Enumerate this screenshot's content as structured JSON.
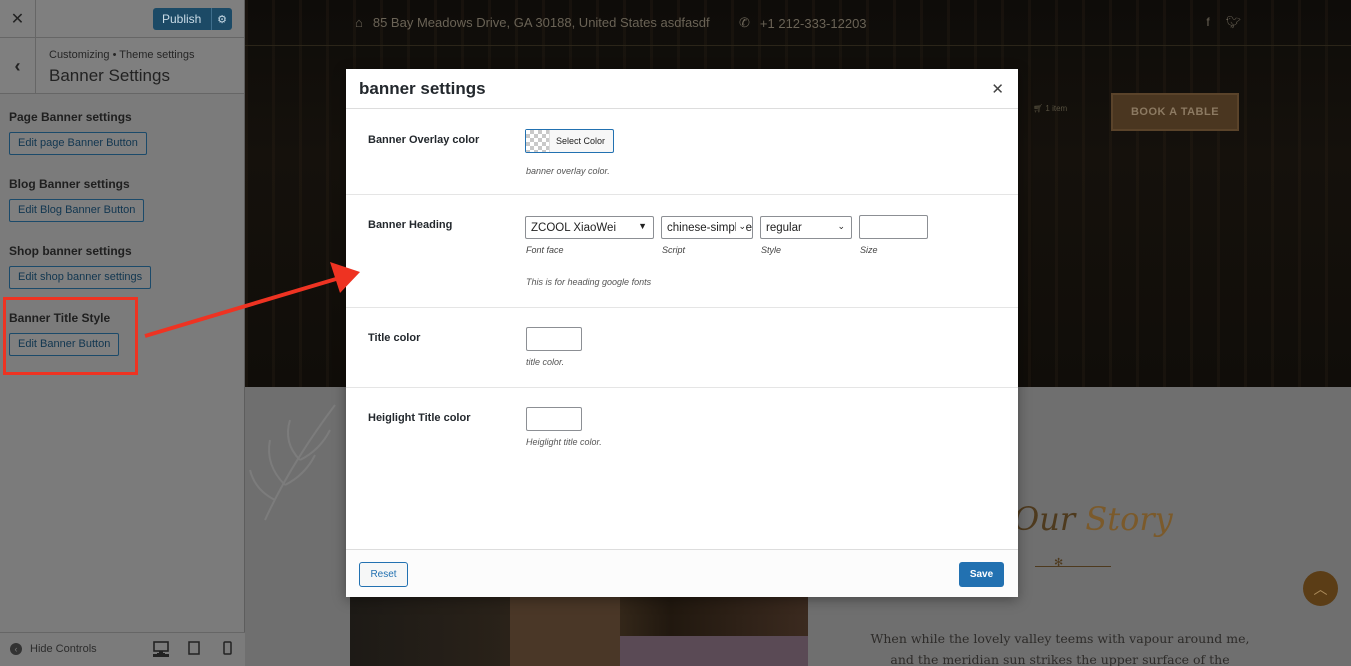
{
  "sidebar": {
    "publish_label": "Publish",
    "breadcrumb": "Customizing • Theme settings",
    "title": "Banner Settings",
    "sections": [
      {
        "heading": "Page Banner settings",
        "button": "Edit page Banner Button"
      },
      {
        "heading": "Blog Banner settings",
        "button": "Edit Blog Banner Button"
      },
      {
        "heading": "Shop banner settings",
        "button": "Edit shop banner settings"
      },
      {
        "heading": "Banner Title Style",
        "button": "Edit Banner Button"
      }
    ],
    "hide_controls": "Hide Controls"
  },
  "preview": {
    "address": "85 Bay Meadows Drive, GA 30188, United States asdfasdf",
    "phone": "+1 212-333-12203",
    "cart_count": "1 item",
    "book_button": "BOOK A TABLE",
    "story_part1": "Our",
    "story_part2": "Story",
    "paragraph_line1": "When while the lovely valley teems with vapour around me,",
    "paragraph_line2": "and the meridian sun strikes the upper surface of the"
  },
  "modal": {
    "title": "banner settings",
    "overlay": {
      "label": "Banner Overlay color",
      "button": "Select Color",
      "description": "banner overlay color."
    },
    "heading": {
      "label": "Banner Heading",
      "font_face_value": "ZCOOL XiaoWei",
      "script_value": "chinese-simplified",
      "style_value": "regular",
      "size_value": "",
      "font_face_label": "Font face",
      "script_label": "Script",
      "style_label": "Style",
      "size_label": "Size",
      "description": "This is for heading google fonts"
    },
    "title_color": {
      "label": "Title color",
      "description": "title color."
    },
    "highlight_color": {
      "label": "Heiglight Title color",
      "description": "Heiglight title color."
    },
    "reset_label": "Reset",
    "save_label": "Save"
  },
  "colors": {
    "accent": "#2271b1",
    "annotation": "#ee3322",
    "brand_gold": "#7b5a2b"
  }
}
